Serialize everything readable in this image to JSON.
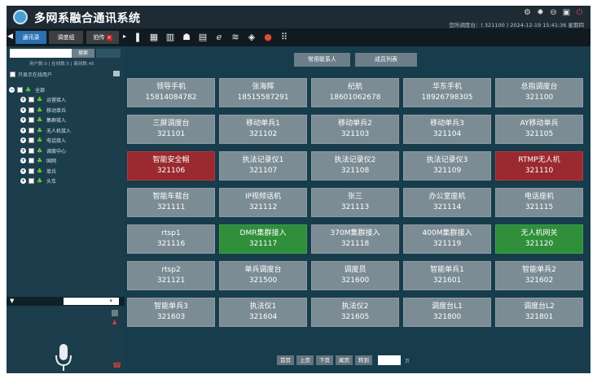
{
  "app": {
    "title": "多网系融合通讯系统",
    "status": "您所调度台：( 321100 )   2024-12-19 15:41:36 星期四"
  },
  "window_icons": [
    "settings-icon",
    "gear-icon",
    "minimize-icon",
    "lock-icon",
    "power-icon"
  ],
  "toolbar": {
    "tabs": [
      "通讯录",
      "调度组",
      "拍传"
    ],
    "icons": [
      "book-icon",
      "calendar-icon",
      "chart-icon",
      "users-icon",
      "document-icon",
      "browser-icon",
      "sliders-icon",
      "layers-icon",
      "alert-icon",
      "grid-icon"
    ]
  },
  "left": {
    "search_placeholder": "",
    "search_button": "搜索",
    "stats": "用户数:0 | 在线数:5 | 离线数:45",
    "online_only_label": "只显示在线用户",
    "tree_root": "全部",
    "tree_children": [
      "运营接入",
      "移动单兵",
      "集群接入",
      "无人机接入",
      "电话接入",
      "调度中心",
      "国网",
      "单兵",
      "头车"
    ]
  },
  "main": {
    "common_contacts": "常用联系人",
    "member_list": "成员列表",
    "cards": [
      {
        "name": "领导手机",
        "number": "15814084782",
        "state": "normal"
      },
      {
        "name": "张海辉",
        "number": "18515587291",
        "state": "normal"
      },
      {
        "name": "纪航",
        "number": "18601062678",
        "state": "normal"
      },
      {
        "name": "华东手机",
        "number": "18926798305",
        "state": "normal"
      },
      {
        "name": "总指调度台",
        "number": "321100",
        "state": "normal"
      },
      {
        "name": "三屏调度台",
        "number": "321101",
        "state": "normal"
      },
      {
        "name": "移动单兵1",
        "number": "321102",
        "state": "normal"
      },
      {
        "name": "移动单兵2",
        "number": "321103",
        "state": "normal"
      },
      {
        "name": "移动单兵3",
        "number": "321104",
        "state": "normal"
      },
      {
        "name": "AY移动单兵",
        "number": "321105",
        "state": "normal"
      },
      {
        "name": "智能安全帽",
        "number": "321106",
        "state": "alert"
      },
      {
        "name": "执法记录仪1",
        "number": "321107",
        "state": "normal"
      },
      {
        "name": "执法记录仪2",
        "number": "321108",
        "state": "normal"
      },
      {
        "name": "执法记录仪3",
        "number": "321109",
        "state": "normal"
      },
      {
        "name": "RTMP无人机",
        "number": "321110",
        "state": "alert"
      },
      {
        "name": "智能车载台",
        "number": "321111",
        "state": "normal"
      },
      {
        "name": "IP视频话机",
        "number": "321112",
        "state": "normal"
      },
      {
        "name": "张三",
        "number": "321113",
        "state": "normal"
      },
      {
        "name": "办公室座机",
        "number": "321114",
        "state": "normal"
      },
      {
        "name": "电话座机",
        "number": "321115",
        "state": "normal"
      },
      {
        "name": "rtsp1",
        "number": "321116",
        "state": "normal"
      },
      {
        "name": "DMR集群接入",
        "number": "321117",
        "state": "online"
      },
      {
        "name": "370M集群接入",
        "number": "321118",
        "state": "normal"
      },
      {
        "name": "400M集群接入",
        "number": "321119",
        "state": "normal"
      },
      {
        "name": "无人机网关",
        "number": "321120",
        "state": "online"
      },
      {
        "name": "rtsp2",
        "number": "321121",
        "state": "normal"
      },
      {
        "name": "单兵调度台",
        "number": "321500",
        "state": "normal"
      },
      {
        "name": "调度员",
        "number": "321600",
        "state": "normal"
      },
      {
        "name": "智能单兵1",
        "number": "321601",
        "state": "normal"
      },
      {
        "name": "智能单兵2",
        "number": "321602",
        "state": "normal"
      },
      {
        "name": "智能单兵3",
        "number": "321603",
        "state": "normal"
      },
      {
        "name": "执法仪1",
        "number": "321604",
        "state": "normal"
      },
      {
        "name": "执法仪2",
        "number": "321605",
        "state": "normal"
      },
      {
        "name": "调度台L1",
        "number": "321800",
        "state": "normal"
      },
      {
        "name": "调度台L2",
        "number": "321801",
        "state": "normal"
      }
    ]
  },
  "pager": {
    "buttons": [
      "首页",
      "上页",
      "下页",
      "尾页",
      "转到"
    ],
    "unit": "页"
  }
}
